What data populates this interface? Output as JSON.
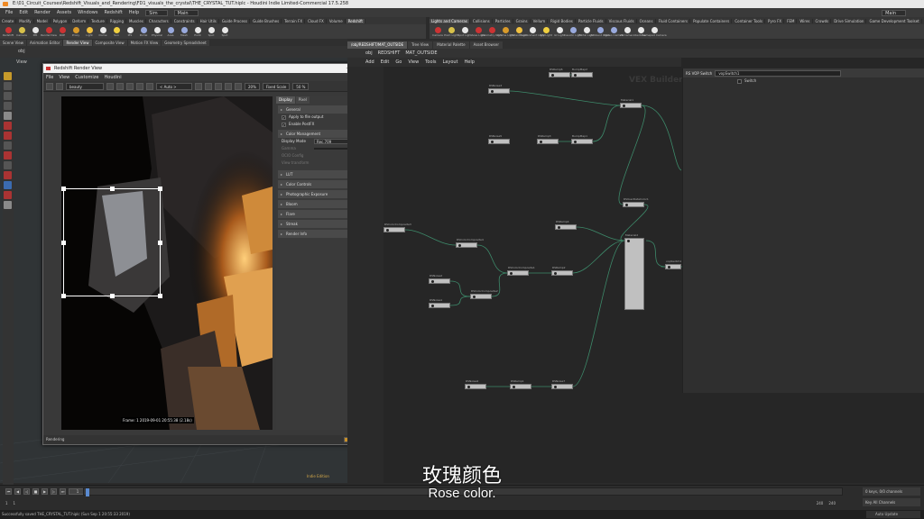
{
  "window": {
    "title": "E:\\01_Circuit_Courses\\Redshift_Visuals_and_Rendering\\FD1_visuals_the_crystal\\THE_CRYSTAL_TUT.hiplc - Houdini Indie Limited-Commercial 17.5.258"
  },
  "menubar": {
    "items": [
      "File",
      "Edit",
      "Render",
      "Assets",
      "Windows",
      "Redshift",
      "Help"
    ],
    "build_dropdown": "Sim",
    "desktop_dropdown": "Main",
    "right_dropdown": "Main"
  },
  "shelf_left": {
    "tabs": [
      "Create",
      "Modify",
      "Model",
      "Polygon",
      "Deform",
      "Texture",
      "Rigging",
      "Muscles",
      "Characters",
      "Constraints",
      "Hair Utils",
      "Guide Process",
      "Guide Brushes",
      "Terrain FX",
      "Cloud FX",
      "Volume",
      "Redshift"
    ],
    "active_tab": "Redshift",
    "tools": [
      "Redshift",
      "Camera",
      "IPR",
      "RenderView",
      "ROP",
      "Proxy",
      "Light",
      "Dome",
      "Sun",
      "IES",
      "Portal",
      "Physical",
      "Area",
      "Mesh",
      "Point",
      "Spot",
      "Spot"
    ]
  },
  "shelf_right": {
    "tabs": [
      "Lights and Cameras",
      "Collisions",
      "Particles",
      "Grains",
      "Vellum",
      "Rigid Bodies",
      "Particle Fluids",
      "Viscous Fluids",
      "Oceans",
      "Fluid Containers",
      "Populate Containers",
      "Container Tools",
      "Pyro FX",
      "FEM",
      "Wires",
      "Crowds",
      "Drive Simulation",
      "Game Development Toolset"
    ],
    "active_tab": "Lights and Cameras",
    "tools": [
      "Camera",
      "Point Light",
      "Spot Light",
      "Area Light",
      "Geometry Light",
      "Volume Light",
      "Distant Light",
      "Environment Light",
      "Sky Light",
      "GI Light",
      "Caustic Light",
      "Portal Light",
      "Ambient Light",
      "Stereo Camera",
      "VR Camera",
      "Switcher",
      "Gamepad Camera"
    ]
  },
  "left_pane_tabs": [
    "Scene View",
    "Animation Editor",
    "Render View",
    "Composite View",
    "Motion FX View",
    "Geometry Spreadsheet"
  ],
  "left_pane_path": "obj",
  "left_pane_view_label": "View",
  "render_view": {
    "title": "Redshift Render View",
    "menu": [
      "File",
      "View",
      "Customize",
      "Houdini"
    ],
    "aov": "beauty",
    "auto": "< Auto >",
    "zoom": "20%",
    "fixed_scale": "Fixed Scale",
    "scale": "50 %",
    "frame_info": "Frame: 1  2019-09-01  20:55:38  (2.18s)",
    "status": "Rendering",
    "progress_label": "9%",
    "progress": 0.09,
    "prop_tabs": [
      "Display",
      "Pixel"
    ],
    "sections": {
      "general": "General",
      "apply_to_file": "Apply to file output",
      "enable_postfx": "Enable PostFX",
      "color_management": "Color Management",
      "display_mode_label": "Display Mode",
      "display_mode_value": "Rec.709",
      "gamma_label": "Gamma",
      "gamma_value": "2.2",
      "ocio_label": "OCIO Config",
      "view_transform_label": "View transform",
      "lut": "LUT",
      "color_controls": "Color Controls",
      "photographic_exposure": "Photographic Exposure",
      "bloom": "Bloom",
      "flare": "Flare",
      "streak": "Streak",
      "render_info": "Render Info"
    }
  },
  "viewport": {
    "badge": "Indie Edition"
  },
  "network": {
    "tabs": [
      "/obj/REDSHIFT/MAT_OUTSIDE",
      "Tree View",
      "Material Palette",
      "Asset Browser"
    ],
    "path": [
      "obj",
      "REDSHIFT",
      "MAT_OUTSIDE"
    ],
    "menu": [
      "Add",
      "Edit",
      "Go",
      "View",
      "Tools",
      "Layout",
      "Help"
    ],
    "context_label": "VEX Builder",
    "nodes": [
      {
        "label": "RSNoise3"
      },
      {
        "label": "RSNoise5"
      },
      {
        "label": "RSRamp3"
      },
      {
        "label": "BumpMap1"
      },
      {
        "label": "Material1"
      },
      {
        "label": "RSUserDataColor1"
      },
      {
        "label": "RSColorComposite4"
      },
      {
        "label": "RSColorComposite3"
      },
      {
        "label": "RSRamp4"
      },
      {
        "label": "RSNoise2"
      },
      {
        "label": "RSNoise1"
      },
      {
        "label": "RSColorComposite1"
      },
      {
        "label": "RSColorComposite2"
      },
      {
        "label": "RSRamp2"
      },
      {
        "label": "Material2"
      },
      {
        "label": "vopSwitch1"
      },
      {
        "label": "RSNoise4"
      },
      {
        "label": "RSRamp1"
      },
      {
        "label": "RSNoise7"
      },
      {
        "label": "RSRamp6"
      },
      {
        "label": "BumpMap2"
      }
    ]
  },
  "rs_panel": {
    "type": "RS VOP Switch",
    "name": "vopSwitch1",
    "row_label": "Switch"
  },
  "timeline": {
    "current_frame": "1",
    "start": "1",
    "start2": "1",
    "end": "240",
    "end2": "240",
    "keys_label": "0 keys, 0/0 channels",
    "key_all": "Key All Channels",
    "auto_update": "Auto Update"
  },
  "status_bar": "Successfully saved THE_CRYSTAL_TUT.hiplc (Sun Sep  1 20:55:33 2019)",
  "subtitles": {
    "zh": "玫瑰颜色",
    "en": "Rose color."
  },
  "colors": {
    "accent_orange": "#f08a24",
    "node_wire": "#3d8a6a",
    "progress": "#c78f2a"
  }
}
